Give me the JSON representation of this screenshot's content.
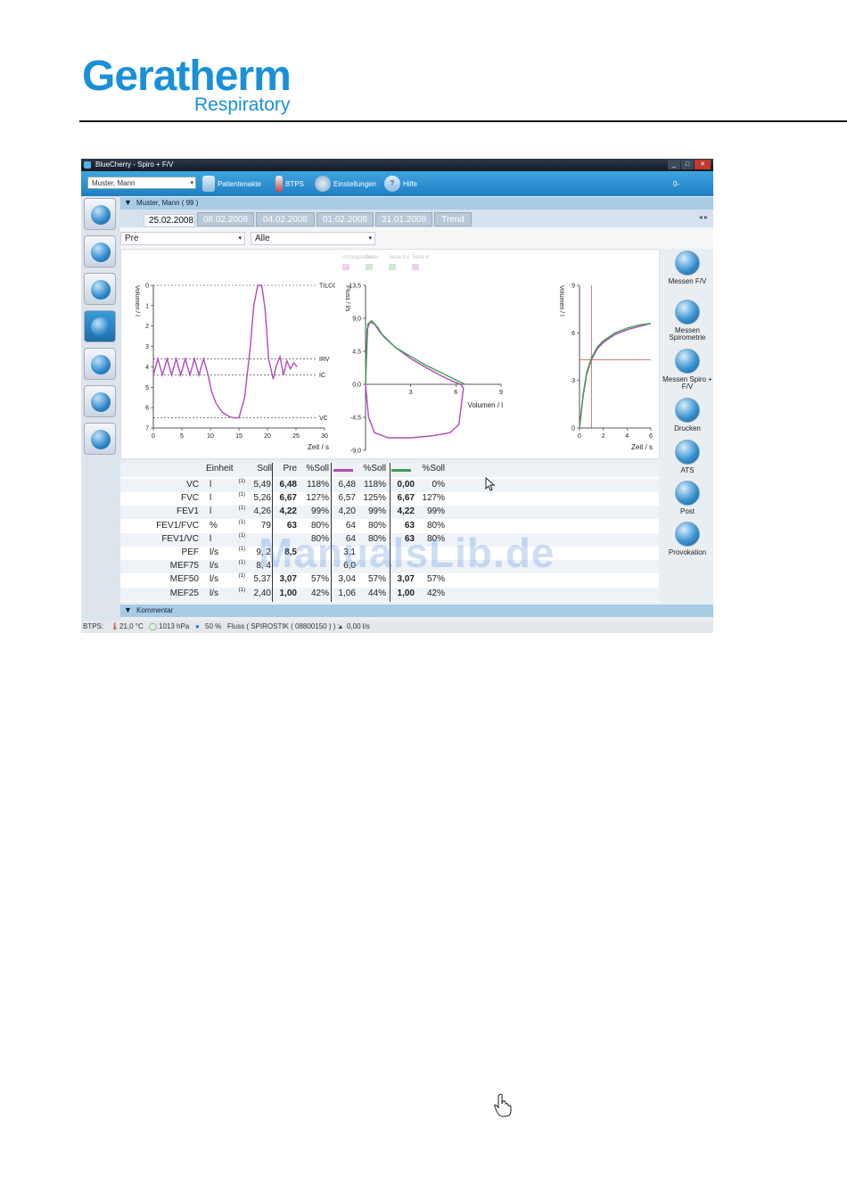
{
  "logo": {
    "main": "Geratherm",
    "sub": "Respiratory"
  },
  "window": {
    "title": "BlueCherry - Spiro + F/V"
  },
  "toolbar": {
    "patient_select": "Muster, Mann",
    "patientenakte": "Patientenakte",
    "btps": "BTPS",
    "einstellungen": "Einstellungen",
    "hilfe": "Hilfe",
    "right_glyph": "0-"
  },
  "patient_header": "Muster, Mann ( 99 )",
  "tabs": [
    "25.02.2008",
    "08.02.2008",
    "04.02.2008",
    "01.02.2008",
    "31.01.2008",
    "Trend"
  ],
  "tab_nav": "◂ ▸",
  "selects": {
    "left": "Pre",
    "right": "Alle"
  },
  "chart_data": [
    {
      "type": "line",
      "title": "",
      "ylabel": "Volumen / l",
      "xlabel": "Zeit / s",
      "xlim": [
        0,
        30
      ],
      "ylim": [
        7,
        0
      ],
      "x_ticks": [
        0,
        5,
        10,
        15,
        20,
        25,
        30
      ],
      "y_ticks": [
        0,
        1,
        2,
        3,
        4,
        5,
        6,
        7
      ],
      "annotations": [
        "TILCOffset",
        "IRV",
        "IC",
        "VC"
      ],
      "reference_lines": [
        {
          "name": "TILCOffset",
          "y": 0
        },
        {
          "name": "IRV",
          "y": 3.6
        },
        {
          "name": "IC",
          "y": 4.4
        },
        {
          "name": "VC",
          "y": 6.5
        }
      ],
      "series": [
        {
          "color": "#b04bb8",
          "x": [
            0,
            0.8,
            1.6,
            2.4,
            3.2,
            4.0,
            4.8,
            5.6,
            6.4,
            7.2,
            8.0,
            8.8,
            9.6,
            10.2,
            11,
            12,
            13,
            14,
            15,
            16,
            17,
            17.6,
            18.3,
            19,
            19.6,
            20.2,
            21,
            21.6,
            22.2,
            22.8,
            23.4,
            24,
            24.6,
            25.2
          ],
          "y": [
            4.4,
            3.6,
            4.4,
            3.6,
            4.4,
            3.6,
            4.4,
            3.6,
            4.4,
            3.6,
            4.4,
            3.6,
            4.4,
            5.2,
            5.8,
            6.2,
            6.4,
            6.5,
            6.5,
            5.5,
            3.0,
            1.0,
            0.0,
            0.0,
            1.2,
            3.6,
            4.6,
            3.9,
            3.5,
            4.4,
            3.7,
            4.1,
            3.8,
            4.0
          ]
        }
      ]
    },
    {
      "type": "line",
      "title": "",
      "ylabel": "Fluss / l/s",
      "xlabel": "Volumen / l",
      "xlim": [
        0,
        9
      ],
      "ylim": [
        -9,
        13.5
      ],
      "x_ticks": [
        3,
        6,
        9
      ],
      "y_ticks": [
        13.5,
        9.0,
        4.5,
        0.0,
        -4.5,
        -9.0
      ],
      "legend": [
        "Anzeigetabel",
        "Serie",
        "Serie Ku",
        "Serie Ir"
      ],
      "series": [
        {
          "color": "#b04bb8",
          "x": [
            0,
            0.1,
            0.3,
            0.6,
            1.0,
            2.0,
            3.0,
            4.0,
            5.0,
            5.8,
            6.3,
            6.5,
            6.2,
            5.6,
            4.5,
            3.0,
            1.5,
            0.6,
            0.2,
            0
          ],
          "y": [
            0,
            7.5,
            8.5,
            8.2,
            7.0,
            5.0,
            3.5,
            2.3,
            1.2,
            0.4,
            0.0,
            -0.5,
            -5.5,
            -6.6,
            -7.0,
            -7.3,
            -7.3,
            -6.6,
            -4.5,
            0
          ]
        },
        {
          "color": "#3f9e55",
          "x": [
            0,
            0.15,
            0.4,
            0.8,
            1.2,
            2.0,
            3.0,
            4.0,
            5.0,
            6.0,
            6.6
          ],
          "y": [
            0,
            8.2,
            8.7,
            7.8,
            6.5,
            5.0,
            3.8,
            2.6,
            1.6,
            0.6,
            0.0
          ]
        }
      ]
    },
    {
      "type": "line",
      "title": "",
      "ylabel": "Volumen / l",
      "xlabel": "Zeit / s",
      "xlim": [
        0,
        6
      ],
      "ylim": [
        0,
        9
      ],
      "x_ticks": [
        0,
        2,
        4,
        6
      ],
      "y_ticks": [
        0,
        3,
        6,
        9
      ],
      "series": [
        {
          "color": "#b04bb8",
          "x": [
            0,
            0.3,
            0.6,
            1.0,
            1.5,
            2.0,
            3.0,
            4.0,
            5.0,
            6.0
          ],
          "y": [
            0,
            2.0,
            3.4,
            4.3,
            5.0,
            5.4,
            5.9,
            6.2,
            6.4,
            6.6
          ]
        },
        {
          "color": "#3f9e55",
          "x": [
            0,
            0.3,
            0.6,
            1.0,
            1.5,
            2.0,
            3.0,
            4.0,
            5.0,
            6.0
          ],
          "y": [
            0,
            2.1,
            3.5,
            4.4,
            5.1,
            5.5,
            6.0,
            6.3,
            6.5,
            6.6
          ]
        }
      ],
      "reference_lines": [
        {
          "x": 1.0
        },
        {
          "y": 4.3
        }
      ]
    }
  ],
  "table": {
    "headers": [
      "Einheit",
      "Soll",
      "Pre",
      "%Soll",
      "",
      "%Soll",
      "",
      "%Soll"
    ],
    "series_colors": {
      "pre2": "#b04bb8",
      "post": "#3f9e55"
    },
    "rows": [
      {
        "name": "VC",
        "unit": "l",
        "note": "(1)",
        "soll": "5,49",
        "pre": "6,48",
        "pct": "118%",
        "v2": "6,48",
        "p2": "118%",
        "v3": "0,00",
        "p3": "0%"
      },
      {
        "name": "FVC",
        "unit": "l",
        "note": "(1)",
        "soll": "5,26",
        "pre": "6,67",
        "pct": "127%",
        "v2": "6,57",
        "p2": "125%",
        "v3": "6,67",
        "p3": "127%"
      },
      {
        "name": "FEV1",
        "unit": "l",
        "note": "(1)",
        "soll": "4,26",
        "pre": "4,22",
        "pct": "99%",
        "v2": "4,20",
        "p2": "99%",
        "v3": "4,22",
        "p3": "99%"
      },
      {
        "name": "FEV1/FVC",
        "unit": "%",
        "note": "(1)",
        "soll": "79",
        "pre": "63",
        "pct": "80%",
        "v2": "64",
        "p2": "80%",
        "v3": "63",
        "p3": "80%"
      },
      {
        "name": "FEV1/VC",
        "unit": "l",
        "note": "(1)",
        "soll": "",
        "pre": "",
        "pct": "80%",
        "v2": "64",
        "p2": "80%",
        "v3": "63",
        "p3": "80%"
      },
      {
        "name": "PEF",
        "unit": "l/s",
        "note": "(1)",
        "soll": "9, 2",
        "pre": "8,5",
        "pct": "",
        "v2": "3,1",
        "p2": "",
        "v3": "",
        "p3": ""
      },
      {
        "name": "MEF75",
        "unit": "l/s",
        "note": "(1)",
        "soll": "8, 4",
        "pre": "",
        "pct": "",
        "v2": "6,0",
        "p2": "",
        "v3": "",
        "p3": ""
      },
      {
        "name": "MEF50",
        "unit": "l/s",
        "note": "(1)",
        "soll": "5,37",
        "pre": "3,07",
        "pct": "57%",
        "v2": "3,04",
        "p2": "57%",
        "v3": "3,07",
        "p3": "57%"
      },
      {
        "name": "MEF25",
        "unit": "l/s",
        "note": "(1)",
        "soll": "2,40",
        "pre": "1,00",
        "pct": "42%",
        "v2": "1,06",
        "p2": "44%",
        "v3": "1,00",
        "p3": "42%"
      }
    ]
  },
  "right_buttons": [
    {
      "label": "Messen F/V"
    },
    {
      "label": "Messen Spirometrie"
    },
    {
      "label": "Messen Spiro + F/V"
    },
    {
      "label": "Drucken"
    },
    {
      "label": "ATS"
    },
    {
      "label": "Post"
    },
    {
      "label": "Provokation"
    }
  ],
  "kommentar": "Kommentar",
  "status": {
    "btps": "BTPS:",
    "temp": "21,0 °C",
    "pressure": "1013 hPa",
    "humidity": "50 %",
    "sensor": "Fluss ( SPIROSTIK ( 08800150 ) ) :",
    "flow": "0,00 l/s"
  },
  "watermark": "ManualsLib.de"
}
